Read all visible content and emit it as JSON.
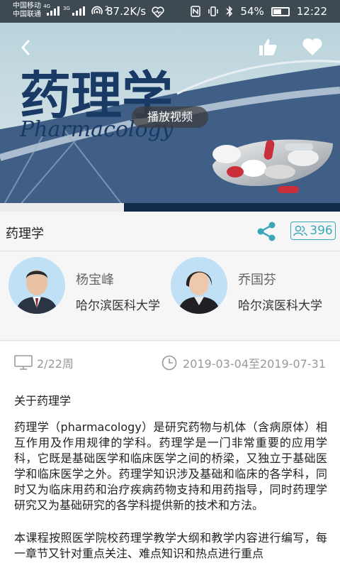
{
  "status_bar": {
    "carrier1": "中国移动",
    "carrier1_net": "4G",
    "carrier2": "中国联通",
    "net2": "3G",
    "hotspot_count": "2",
    "speed": "87.2K/s",
    "battery": "54%",
    "time": "12:22"
  },
  "hero": {
    "cover_title": "药理学",
    "cover_subtitle": "Pharmacology",
    "play_label": "播放视频"
  },
  "course": {
    "title": "药理学",
    "member_count": "396"
  },
  "teachers": [
    {
      "name": "杨宝峰",
      "school": "哈尔滨医科大学"
    },
    {
      "name": "乔国芬",
      "school": "哈尔滨医科大学"
    }
  ],
  "meta": {
    "weeks": "2/22周",
    "date_range": "2019-03-04至2019-07-31"
  },
  "intro": {
    "heading": "关于药理学",
    "paragraph1": "药理学（pharmacology）是研究药物与机体（含病原体）相互作用及作用规律的学科。药理学是一门非常重要的应用学科，它既是基础医学和临床医学之间的桥梁，又独立于基础医学和临床医学之外。药理学知识涉及基础和临床的各学科，同时又为临床用药和治疗疾病药物支持和用药指导，同时药理学研究又为基础研究的各学科提供新的技术和方法。",
    "paragraph2": "本课程按照医学院校药理学教学大纲和教学内容进行编写，每一章节又针对重点关注、难点知识和热点进行重点"
  },
  "video_progress": 0.365,
  "colors": {
    "accent": "#3aa7b9",
    "status_bar": "#3e4a52",
    "hero_dark": "#0f2a4a"
  }
}
